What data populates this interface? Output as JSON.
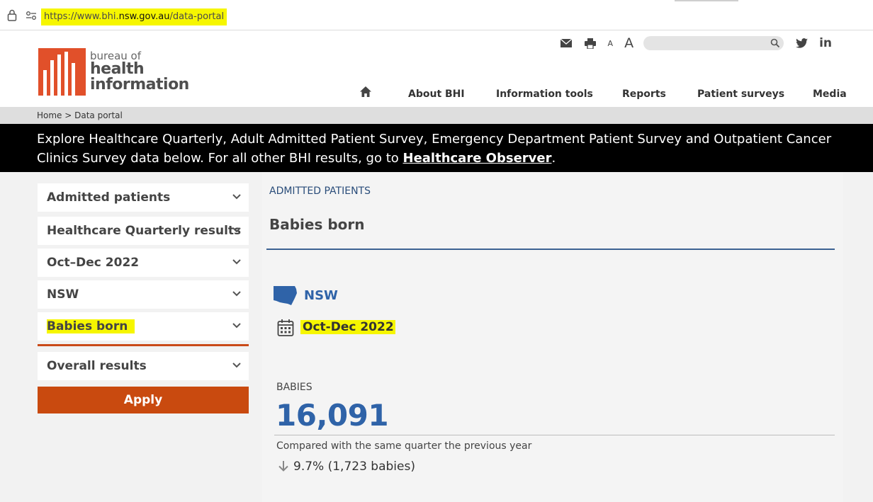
{
  "browser": {
    "url_prefix": "https://www.bhi.",
    "url_domain": "nsw.gov.au",
    "url_path": "/data-portal"
  },
  "logo": {
    "line1": "bureau of",
    "line2": "health",
    "line3": "information"
  },
  "tools": {
    "font_small": "A",
    "font_large": "A",
    "linkedin": "in"
  },
  "nav": {
    "items": [
      "About BHI",
      "Information tools",
      "Reports",
      "Patient surveys",
      "Media"
    ]
  },
  "breadcrumb": "Home > Data portal",
  "banner": {
    "text": "Explore Healthcare Quarterly, Adult Admitted Patient Survey, Emergency Department Patient Survey and Outpatient Cancer Clinics Survey data below. For all other BHI results, go to ",
    "link": "Healthcare Observer",
    "suffix": "."
  },
  "sidebar": {
    "selects": [
      "Admitted patients",
      "Healthcare Quarterly results",
      "Oct–Dec 2022",
      "NSW",
      "Babies born",
      "Overall results"
    ],
    "apply_label": "Apply"
  },
  "main": {
    "section": "ADMITTED PATIENTS",
    "title": "Babies born",
    "region": "NSW",
    "period": "Oct-Dec 2022",
    "metric_label": "BABIES",
    "metric_value": "16,091",
    "compare_text": "Compared with the same quarter the previous year",
    "change_text": "9.7% (1,723 babies)"
  },
  "colors": {
    "brand_orange": "#e1502a",
    "apply_orange": "#c94a0f",
    "accent_blue": "#2f63a8",
    "highlight": "#f6f600"
  }
}
